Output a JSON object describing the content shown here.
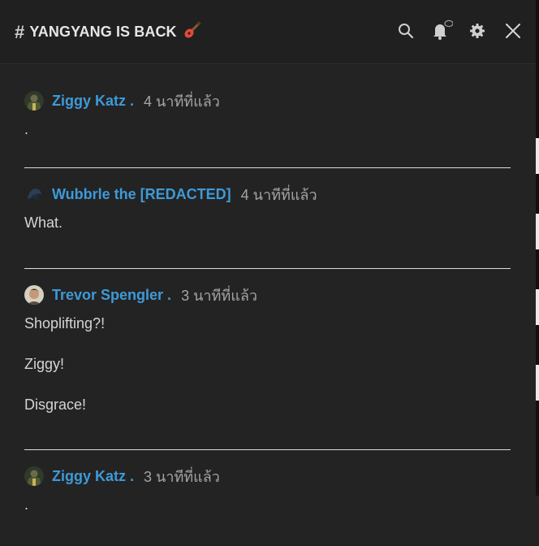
{
  "header": {
    "channel_title": "YANGYANG IS BACK"
  },
  "messages": [
    {
      "author": "Ziggy Katz .",
      "time": "4 นาทีที่แล้ว",
      "lines": [
        "."
      ]
    },
    {
      "author": "Wubbrle the [REDACTED]",
      "time": "4 นาทีที่แล้ว",
      "lines": [
        "What."
      ]
    },
    {
      "author": "Trevor Spengler .",
      "time": "3 นาทีที่แล้ว",
      "lines": [
        "Shoplifting?!",
        "Ziggy!",
        "Disgrace!"
      ]
    },
    {
      "author": "Ziggy Katz .",
      "time": "3 นาทีที่แล้ว",
      "lines": [
        "."
      ]
    }
  ],
  "colors": {
    "background": "#232323",
    "author_link": "#3d9ad8",
    "timestamp": "#a3a3a3",
    "body_text": "#d4d4d4",
    "divider": "#dcdcdc"
  },
  "icons": [
    "hash-icon",
    "guitar-emoji",
    "search-icon",
    "notification-bell-icon",
    "settings-gear-icon",
    "close-icon"
  ]
}
